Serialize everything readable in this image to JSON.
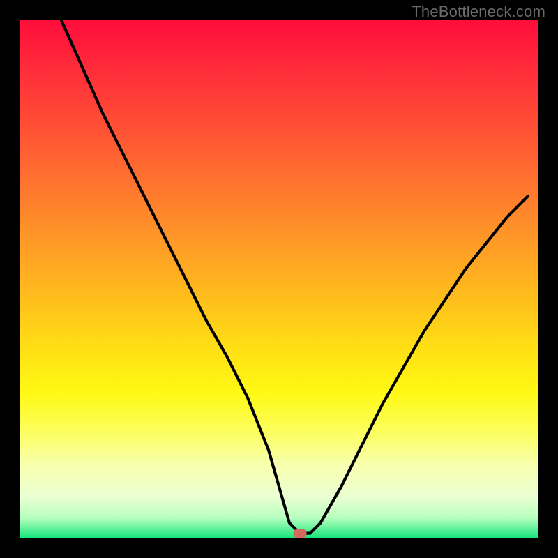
{
  "watermark": "TheBottleneck.com",
  "colors": {
    "frame_bg": "#000000",
    "curve_stroke": "#000000",
    "marker_fill": "#d46a5b",
    "gradient_top": "#ff0d3b",
    "gradient_bottom": "#13e479"
  },
  "chart_data": {
    "type": "line",
    "title": "",
    "xlabel": "",
    "ylabel": "",
    "xlim": [
      0,
      100
    ],
    "ylim": [
      0,
      100
    ],
    "grid": false,
    "legend": false,
    "annotations": [
      {
        "text": "TheBottleneck.com",
        "position": "top-right"
      }
    ],
    "marker": {
      "x": 54,
      "y": 1
    },
    "series": [
      {
        "name": "bottleneck-curve",
        "x": [
          8,
          12,
          16,
          20,
          24,
          28,
          32,
          36,
          40,
          44,
          48,
          50,
          52,
          54,
          56,
          58,
          62,
          66,
          70,
          74,
          78,
          82,
          86,
          90,
          94,
          98
        ],
        "y": [
          100,
          91,
          82,
          74,
          66,
          58,
          50,
          42,
          35,
          27,
          17,
          10,
          3,
          1,
          1,
          3,
          10,
          18,
          26,
          33,
          40,
          46,
          52,
          57,
          62,
          66
        ]
      }
    ]
  }
}
